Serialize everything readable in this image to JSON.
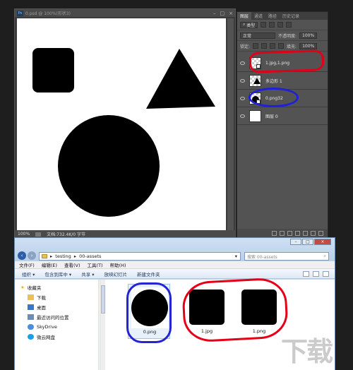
{
  "ps_window": {
    "title": "0.psd @ 100%(形状3)",
    "status_zoom": "100%",
    "status_doc": "文档:732.4K/0 字节"
  },
  "layers_panel": {
    "tabs": [
      "图层",
      "通道",
      "路径",
      "历史记录"
    ],
    "filter_kind": "类型",
    "blend_mode": "正常",
    "opacity_label": "不透明度:",
    "opacity_value": "100%",
    "lock_label": "锁定:",
    "fill_label": "填充:",
    "fill_value": "100%",
    "layers": [
      {
        "name": "1.jpg,1.png"
      },
      {
        "name": "多边形 1"
      },
      {
        "name": "0.png32"
      },
      {
        "name": "图层 0"
      }
    ]
  },
  "explorer": {
    "path": [
      "testing",
      "00-assets"
    ],
    "search_placeholder": "搜索 00-assets",
    "menu": [
      "文件(F)",
      "编辑(E)",
      "查看(V)",
      "工具(T)",
      "帮助(H)"
    ],
    "toolbar": [
      "组织 ▾",
      "包含到库中 ▾",
      "共享 ▾",
      "放映幻灯片",
      "新建文件夹"
    ],
    "sidebar": [
      {
        "label": "收藏夹",
        "level": 1
      },
      {
        "label": "下载",
        "level": 2
      },
      {
        "label": "桌面",
        "level": 2
      },
      {
        "label": "最近访问的位置",
        "level": 2
      },
      {
        "label": "SkyDrive",
        "level": 2
      },
      {
        "label": "微云网盘",
        "level": 2
      }
    ],
    "files": [
      {
        "name": "0.png"
      },
      {
        "name": "1.jpg"
      },
      {
        "name": "1.png"
      }
    ]
  },
  "watermark": "下载",
  "colors": {
    "annotation_red": "#e0001a",
    "annotation_blue": "#2020d8",
    "ps_dark": "#535353"
  }
}
